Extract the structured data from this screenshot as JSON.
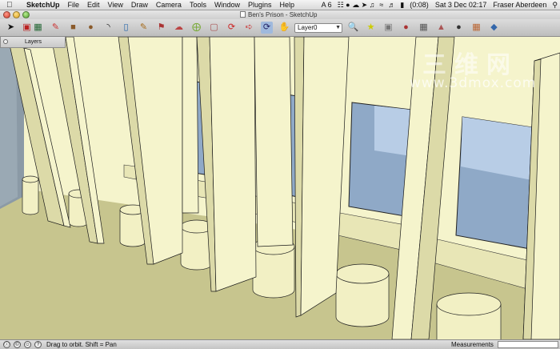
{
  "menubar": {
    "app": "SketchUp",
    "items": [
      "File",
      "Edit",
      "View",
      "Draw",
      "Camera",
      "Tools",
      "Window",
      "Plugins",
      "Help"
    ],
    "adobe": "A 6",
    "battery": "(0:08)",
    "datetime": "Sat 3 Dec  02:17",
    "user": "Fraser Aberdeen"
  },
  "window": {
    "title": "Ben's Prison - SketchUp"
  },
  "toolbar": {
    "layer": "Layer0"
  },
  "layers_panel": {
    "title": "Layers"
  },
  "watermark": {
    "cn": "三维网",
    "url": "www.3dmox.com"
  },
  "statusbar": {
    "hint": "Drag to orbit.  Shift = Pan",
    "measurements_label": "Measurements"
  },
  "colors": {
    "wall": "#f5f4cc",
    "wall_shadow": "#dcdaa8",
    "floor": "#c7c58e",
    "glass": "#8fa9c7",
    "glass_light": "#b8cde6"
  }
}
